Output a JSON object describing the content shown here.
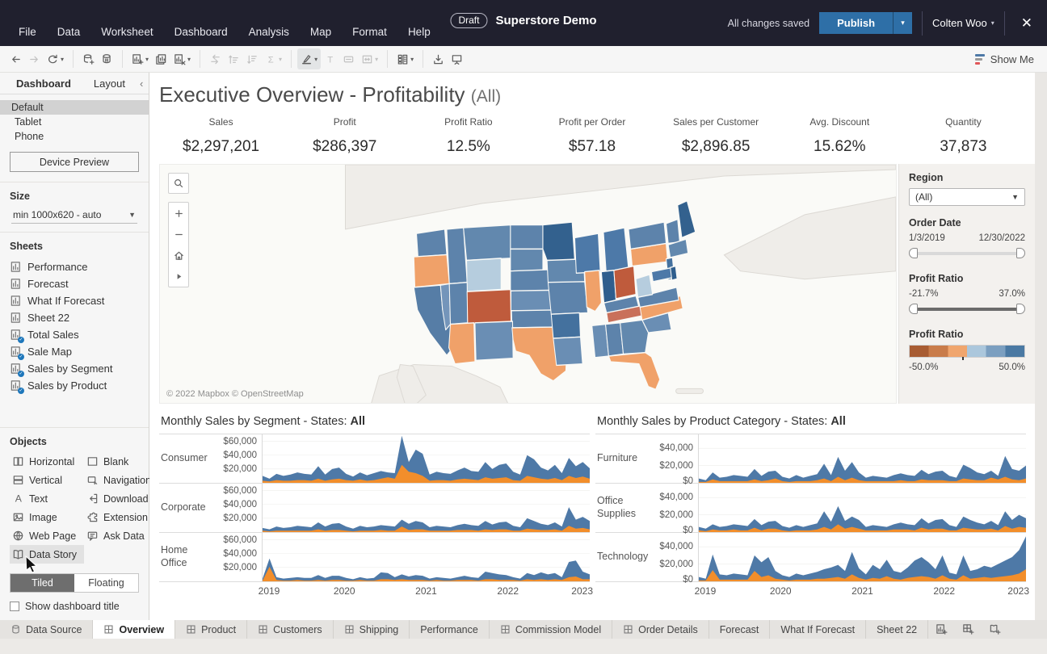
{
  "titlebar": {
    "menus": [
      "File",
      "Data",
      "Worksheet",
      "Dashboard",
      "Analysis",
      "Map",
      "Format",
      "Help"
    ],
    "draft_badge": "Draft",
    "title": "Superstore Demo",
    "saved_status": "All changes saved",
    "publish_label": "Publish",
    "user": "Colten Woo",
    "close_glyph": "✕"
  },
  "toolbar": {
    "show_me_label": "Show Me",
    "icons": [
      {
        "name": "undo",
        "enabled": true
      },
      {
        "name": "redo",
        "enabled": false
      },
      {
        "name": "replay",
        "enabled": true,
        "caret": true
      },
      {
        "name": "sep"
      },
      {
        "name": "add-data-source",
        "enabled": true
      },
      {
        "name": "pause-auto-updates",
        "enabled": true
      },
      {
        "name": "sep"
      },
      {
        "name": "new-worksheet",
        "enabled": true,
        "caret": true
      },
      {
        "name": "duplicate-sheet",
        "enabled": true
      },
      {
        "name": "clear-sheet",
        "enabled": true,
        "caret": true
      },
      {
        "name": "sep"
      },
      {
        "name": "swap-rows-columns",
        "enabled": false
      },
      {
        "name": "sort-ascending",
        "enabled": false
      },
      {
        "name": "sort-descending",
        "enabled": false
      },
      {
        "name": "totals",
        "enabled": false,
        "caret": true
      },
      {
        "name": "sep"
      },
      {
        "name": "highlight",
        "enabled": true,
        "caret": true,
        "highlighted": true
      },
      {
        "name": "format-text",
        "enabled": false
      },
      {
        "name": "show-mark-labels",
        "enabled": false
      },
      {
        "name": "fit",
        "enabled": false,
        "caret": true
      },
      {
        "name": "sep"
      },
      {
        "name": "show-hide-cards",
        "enabled": true,
        "caret": true
      },
      {
        "name": "sep"
      },
      {
        "name": "download",
        "enabled": true
      },
      {
        "name": "presentation-mode",
        "enabled": true
      }
    ],
    "show_me_colors": [
      "#4e79a7",
      "#9a9a9a",
      "#e15759"
    ]
  },
  "sidebar": {
    "tabs": [
      {
        "label": "Dashboard",
        "active": true
      },
      {
        "label": "Layout",
        "active": false
      }
    ],
    "collapse_glyph": "‹",
    "device_options": [
      "Default",
      "Tablet",
      "Phone"
    ],
    "device_selected": "Default",
    "device_preview_label": "Device Preview",
    "size_label": "Size",
    "size_value": "min 1000x620 - auto",
    "sheets_label": "Sheets",
    "sheets": [
      {
        "label": "Performance",
        "in_dashboard": false
      },
      {
        "label": "Forecast",
        "in_dashboard": false
      },
      {
        "label": "What If Forecast",
        "in_dashboard": false
      },
      {
        "label": "Sheet 22",
        "in_dashboard": false
      },
      {
        "label": "Total Sales",
        "in_dashboard": true
      },
      {
        "label": "Sale Map",
        "in_dashboard": true
      },
      {
        "label": "Sales by Segment",
        "in_dashboard": true
      },
      {
        "label": "Sales by Product",
        "in_dashboard": true
      }
    ],
    "objects_label": "Objects",
    "objects": [
      {
        "id": "horizontal",
        "label": "Horizontal"
      },
      {
        "id": "blank",
        "label": "Blank"
      },
      {
        "id": "vertical",
        "label": "Vertical"
      },
      {
        "id": "navigation",
        "label": "Navigation"
      },
      {
        "id": "text",
        "label": "Text"
      },
      {
        "id": "download",
        "label": "Download"
      },
      {
        "id": "image",
        "label": "Image"
      },
      {
        "id": "extension",
        "label": "Extension"
      },
      {
        "id": "web-page",
        "label": "Web Page"
      },
      {
        "id": "ask-data",
        "label": "Ask Data"
      },
      {
        "id": "data-story",
        "label": "Data Story",
        "highlighted": true
      }
    ],
    "tiled_label": "Tiled",
    "floating_label": "Floating",
    "tiled_selected": true,
    "show_title_label": "Show dashboard title",
    "show_title_checked": false
  },
  "dashboard": {
    "title": "Executive Overview - Profitability ",
    "title_suffix": "(All)",
    "kpis": [
      {
        "label": "Sales",
        "value": "$2,297,201"
      },
      {
        "label": "Profit",
        "value": "$286,397"
      },
      {
        "label": "Profit Ratio",
        "value": "12.5%"
      },
      {
        "label": "Profit per Order",
        "value": "$57.18"
      },
      {
        "label": "Sales per Customer",
        "value": "$2,896.85"
      },
      {
        "label": "Avg. Discount",
        "value": "15.62%"
      },
      {
        "label": "Quantity",
        "value": "37,873"
      }
    ],
    "map": {
      "attribution": "© 2022 Mapbox  © OpenStreetMap",
      "controls": [
        "zoom-area-search",
        "zoom-in",
        "zoom-out",
        "zoom-home",
        "pan-right"
      ],
      "states": {
        "WA": "#5d83ab",
        "OR": "#f0a169",
        "CA": "#567da6",
        "NV": "#7495ba",
        "ID": "#5d83ab",
        "MT": "#6288ae",
        "WY": "#b6cdde",
        "UT": "#5d83ab",
        "CO": "#bf5b3c",
        "AZ": "#f0a169",
        "NM": "#6a8eb4",
        "ND": "#5d83ab",
        "SD": "#6288ae",
        "NE": "#5d83ab",
        "KS": "#6a8eb4",
        "OK": "#5d83ab",
        "TX": "#f0a169",
        "MN": "#33618e",
        "IA": "#6288ae",
        "MO": "#5d83ab",
        "AR": "#44719e",
        "LA": "#6a8eb4",
        "WI": "#4d79a8",
        "IL": "#f0a169",
        "MI": "#4d79a8",
        "IN": "#2f5e8d",
        "OH": "#bf5b3c",
        "KY": "#5d83ab",
        "TN": "#c9705a",
        "MS": "#6a8eb4",
        "AL": "#5d83ab",
        "GA": "#6288ae",
        "FL": "#f0a169",
        "SC": "#6a8eb4",
        "NC": "#f0a169",
        "VA": "#5d83ab",
        "WV": "#b6cdde",
        "PA": "#f0a169",
        "NY": "#5d83ab",
        "NJ": "#44719e",
        "MD": "#4d79a8",
        "DE": "#2f5e8d",
        "VT": "#5d83ab",
        "MA": "#6288ae",
        "ME": "#33618e"
      }
    },
    "filters": {
      "region_label": "Region",
      "region_value": "(All)",
      "order_date_label": "Order Date",
      "order_date_min": "1/3/2019",
      "order_date_max": "12/30/2022",
      "profit_ratio_label": "Profit Ratio",
      "profit_ratio_min": "-21.7%",
      "profit_ratio_max": "37.0%",
      "legend_label": "Profit Ratio",
      "legend_min": "-50.0%",
      "legend_max": "50.0%",
      "legend_colors": [
        "#a85c32",
        "#c97c4a",
        "#f0a66e",
        "#abc7dc",
        "#7b9fc0",
        "#4a79a3"
      ]
    }
  },
  "chart_data": [
    {
      "type": "area",
      "title": "Monthly Sales by Segment - States: ",
      "title_bold": "All",
      "unit": "USD thousands per month",
      "x_years": [
        "2019",
        "2020",
        "2021",
        "2022",
        "2023"
      ],
      "y_ticks": [
        "$60,000",
        "$40,000",
        "$20,000"
      ],
      "y_tick_values": [
        60,
        40,
        20
      ],
      "y_max": 70,
      "series_colors": {
        "sales": "#4e79a7",
        "profit": "#f28e2b"
      },
      "rows": [
        {
          "label": "Consumer",
          "sales": [
            10,
            6,
            13,
            10,
            12,
            15,
            13,
            12,
            24,
            12,
            20,
            22,
            13,
            9,
            15,
            11,
            14,
            17,
            15,
            14,
            68,
            30,
            48,
            42,
            12,
            16,
            14,
            13,
            18,
            22,
            17,
            16,
            30,
            20,
            26,
            28,
            16,
            12,
            40,
            34,
            22,
            18,
            26,
            14,
            36,
            24,
            30,
            21
          ],
          "profit": [
            3,
            2,
            4,
            3,
            3,
            4,
            4,
            3,
            6,
            3,
            5,
            6,
            4,
            3,
            5,
            3,
            4,
            6,
            8,
            6,
            26,
            16,
            14,
            10,
            3,
            4,
            4,
            3,
            5,
            6,
            5,
            4,
            8,
            6,
            7,
            8,
            4,
            3,
            10,
            8,
            6,
            5,
            7,
            4,
            10,
            7,
            9,
            6
          ]
        },
        {
          "label": "Corporate",
          "sales": [
            6,
            4,
            8,
            6,
            7,
            9,
            8,
            7,
            14,
            8,
            12,
            13,
            8,
            5,
            9,
            7,
            8,
            10,
            9,
            8,
            18,
            12,
            16,
            14,
            7,
            9,
            8,
            7,
            10,
            12,
            10,
            9,
            16,
            11,
            14,
            15,
            9,
            7,
            20,
            16,
            12,
            10,
            14,
            8,
            36,
            18,
            22,
            16
          ],
          "profit": [
            2,
            1,
            2,
            2,
            2,
            2,
            2,
            2,
            4,
            2,
            3,
            3,
            2,
            1,
            2,
            2,
            2,
            3,
            2,
            2,
            8,
            3,
            4,
            4,
            2,
            2,
            2,
            2,
            3,
            3,
            3,
            2,
            4,
            3,
            4,
            4,
            2,
            2,
            5,
            4,
            3,
            3,
            4,
            2,
            9,
            5,
            6,
            4
          ]
        },
        {
          "label": "Home Office",
          "sales": [
            4,
            33,
            6,
            4,
            5,
            6,
            5,
            5,
            9,
            5,
            8,
            8,
            5,
            3,
            6,
            4,
            5,
            13,
            12,
            6,
            10,
            7,
            9,
            8,
            4,
            6,
            5,
            4,
            6,
            8,
            6,
            5,
            14,
            12,
            10,
            9,
            6,
            4,
            12,
            9,
            13,
            10,
            12,
            6,
            28,
            30,
            14,
            10
          ],
          "profit": [
            1,
            21,
            2,
            1,
            1,
            2,
            1,
            1,
            2,
            1,
            2,
            2,
            1,
            1,
            2,
            1,
            1,
            3,
            3,
            2,
            3,
            2,
            2,
            2,
            1,
            2,
            1,
            1,
            2,
            2,
            2,
            1,
            3,
            3,
            2,
            2,
            2,
            1,
            3,
            2,
            3,
            2,
            3,
            2,
            6,
            7,
            3,
            3
          ]
        }
      ]
    },
    {
      "type": "area",
      "title": "Monthly Sales by Product Category - States: ",
      "title_bold": "All",
      "unit": "USD thousands per month",
      "x_years": [
        "2019",
        "2020",
        "2021",
        "2022",
        "2023"
      ],
      "y_ticks": [
        "$40,000",
        "$20,000",
        "$0"
      ],
      "y_tick_values": [
        40,
        20,
        0
      ],
      "y_max": 56,
      "series_colors": {
        "sales": "#4e79a7",
        "profit": "#f28e2b"
      },
      "rows": [
        {
          "label": "Furniture",
          "sales": [
            5,
            3,
            12,
            6,
            7,
            9,
            8,
            7,
            16,
            8,
            13,
            14,
            7,
            5,
            9,
            6,
            8,
            10,
            22,
            9,
            30,
            14,
            24,
            12,
            6,
            8,
            7,
            6,
            9,
            11,
            9,
            8,
            15,
            10,
            13,
            14,
            8,
            6,
            21,
            17,
            12,
            10,
            14,
            8,
            31,
            16,
            14,
            20
          ],
          "profit": [
            1,
            1,
            4,
            2,
            2,
            2,
            2,
            2,
            4,
            2,
            3,
            5,
            2,
            1,
            2,
            2,
            2,
            3,
            5,
            2,
            7,
            3,
            6,
            3,
            2,
            2,
            2,
            2,
            2,
            3,
            2,
            2,
            4,
            3,
            3,
            3,
            2,
            2,
            5,
            4,
            3,
            3,
            6,
            4,
            7,
            4,
            3,
            5
          ]
        },
        {
          "label": "Office Supplies",
          "sales": [
            6,
            4,
            9,
            6,
            7,
            9,
            8,
            7,
            15,
            8,
            12,
            13,
            7,
            5,
            8,
            6,
            8,
            10,
            24,
            12,
            30,
            13,
            18,
            14,
            6,
            8,
            7,
            6,
            9,
            11,
            9,
            8,
            16,
            10,
            14,
            15,
            8,
            6,
            18,
            14,
            11,
            9,
            13,
            8,
            24,
            14,
            20,
            16
          ],
          "profit": [
            2,
            1,
            3,
            2,
            2,
            3,
            2,
            2,
            5,
            2,
            4,
            4,
            2,
            1,
            2,
            2,
            2,
            3,
            6,
            3,
            9,
            4,
            6,
            4,
            2,
            2,
            2,
            2,
            3,
            3,
            3,
            2,
            5,
            3,
            4,
            4,
            2,
            2,
            5,
            4,
            3,
            3,
            4,
            2,
            7,
            4,
            6,
            5
          ]
        },
        {
          "label": "Technology",
          "sales": [
            5,
            3,
            31,
            8,
            7,
            9,
            8,
            7,
            30,
            22,
            28,
            12,
            7,
            5,
            9,
            7,
            9,
            11,
            14,
            16,
            19,
            12,
            34,
            15,
            8,
            19,
            14,
            25,
            12,
            10,
            16,
            24,
            28,
            22,
            14,
            30,
            10,
            8,
            30,
            12,
            14,
            18,
            16,
            20,
            24,
            28,
            36,
            52
          ],
          "profit": [
            1,
            1,
            13,
            2,
            2,
            2,
            2,
            2,
            12,
            5,
            7,
            3,
            2,
            1,
            2,
            2,
            2,
            3,
            3,
            4,
            5,
            3,
            8,
            4,
            2,
            4,
            3,
            6,
            3,
            2,
            4,
            5,
            6,
            5,
            3,
            7,
            3,
            2,
            7,
            3,
            4,
            5,
            4,
            5,
            6,
            7,
            9,
            14
          ]
        }
      ]
    }
  ],
  "tabbar": {
    "tabs": [
      {
        "label": "Data Source",
        "icon": "datasource",
        "active": false
      },
      {
        "label": "Overview",
        "icon": "dashboard",
        "active": true
      },
      {
        "label": "Product",
        "icon": "dashboard",
        "active": false
      },
      {
        "label": "Customers",
        "icon": "dashboard",
        "active": false
      },
      {
        "label": "Shipping",
        "icon": "dashboard",
        "active": false
      },
      {
        "label": "Performance",
        "icon": "none",
        "active": false
      },
      {
        "label": "Commission Model",
        "icon": "dashboard",
        "active": false
      },
      {
        "label": "Order Details",
        "icon": "dashboard",
        "active": false
      },
      {
        "label": "Forecast",
        "icon": "none",
        "active": false
      },
      {
        "label": "What If Forecast",
        "icon": "none",
        "active": false
      },
      {
        "label": "Sheet 22",
        "icon": "none",
        "active": false
      }
    ],
    "new_buttons": [
      "new-worksheet-tab",
      "new-dashboard-tab",
      "new-story-tab"
    ]
  }
}
